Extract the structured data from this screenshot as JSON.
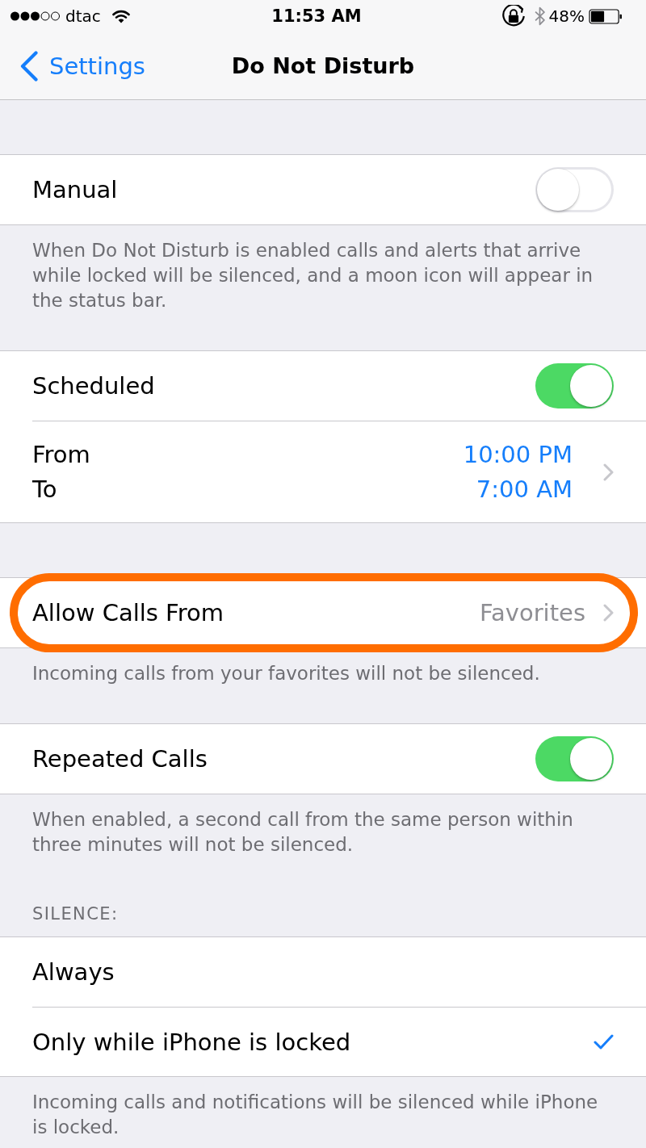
{
  "status_bar": {
    "carrier": "dtac",
    "time": "11:53 AM",
    "battery": "48%"
  },
  "nav_bar": {
    "back_label": "Settings",
    "title": "Do Not Disturb"
  },
  "sections": [
    {
      "rows": [
        {
          "kind": "toggle",
          "label": "Manual",
          "on": false
        }
      ],
      "footer": "When Do Not Disturb is enabled calls and alerts that arrive while locked will be silenced, and a moon icon will appear in the status bar."
    },
    {
      "rows": [
        {
          "kind": "toggle",
          "label": "Scheduled",
          "on": true
        },
        {
          "kind": "schedule",
          "from_label": "From",
          "from_value": "10:00 PM",
          "to_label": "To",
          "to_value": "7:00 AM"
        }
      ]
    },
    {
      "rows": [
        {
          "kind": "disclosure",
          "label": "Allow Calls From",
          "value": "Favorites",
          "highlighted": true
        }
      ],
      "footer": "Incoming calls from your favorites will not be silenced."
    },
    {
      "rows": [
        {
          "kind": "toggle",
          "label": "Repeated Calls",
          "on": true
        }
      ],
      "footer": "When enabled, a second call from the same person within three minutes will not be silenced."
    },
    {
      "header": "SILENCE:",
      "rows": [
        {
          "kind": "option",
          "label": "Always",
          "selected": false
        },
        {
          "kind": "option",
          "label": "Only while iPhone is locked",
          "selected": true
        }
      ],
      "footer": "Incoming calls and notifications will be silenced while iPhone is locked."
    }
  ]
}
